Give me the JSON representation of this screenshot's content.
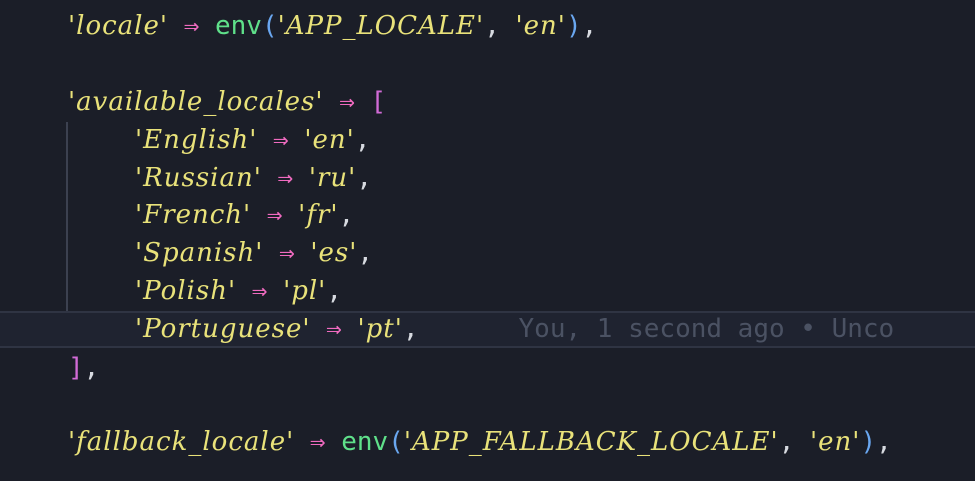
{
  "colors": {
    "background": "#1b1e28",
    "string": "#e9e27a",
    "arrow": "#f06bc0",
    "function": "#5fe08a",
    "paren": "#6aa7f0",
    "bracket": "#d16bd6",
    "blame": "#4b5263"
  },
  "code": {
    "locale": {
      "key": "'locale'",
      "arrow": "⇒",
      "fn": "env",
      "open": "(",
      "arg1": "'APP_LOCALE'",
      "comma": ",",
      "arg2": "'en'",
      "close": ")",
      "end": ","
    },
    "available": {
      "key": "'available_locales'",
      "arrow": "⇒",
      "open": "["
    },
    "entries": [
      {
        "key": "'English'",
        "arrow": "⇒",
        "value": "'en'",
        "end": ","
      },
      {
        "key": "'Russian'",
        "arrow": "⇒",
        "value": "'ru'",
        "end": ","
      },
      {
        "key": "'French'",
        "arrow": "⇒",
        "value": "'fr'",
        "end": ","
      },
      {
        "key": "'Spanish'",
        "arrow": "⇒",
        "value": "'es'",
        "end": ","
      },
      {
        "key": "'Polish'",
        "arrow": "⇒",
        "value": "'pl'",
        "end": ","
      },
      {
        "key": "'Portuguese'",
        "arrow": "⇒",
        "value": "'pt'",
        "end": ","
      }
    ],
    "close_bracket": "]",
    "close_end": ",",
    "fallback": {
      "key": "'fallback_locale'",
      "arrow": "⇒",
      "fn": "env",
      "open": "(",
      "arg1": "'APP_FALLBACK_LOCALE'",
      "comma": ",",
      "arg2": "'en'",
      "close": ")",
      "end": ","
    }
  },
  "blame": {
    "text": "You, 1 second ago • Unco"
  }
}
